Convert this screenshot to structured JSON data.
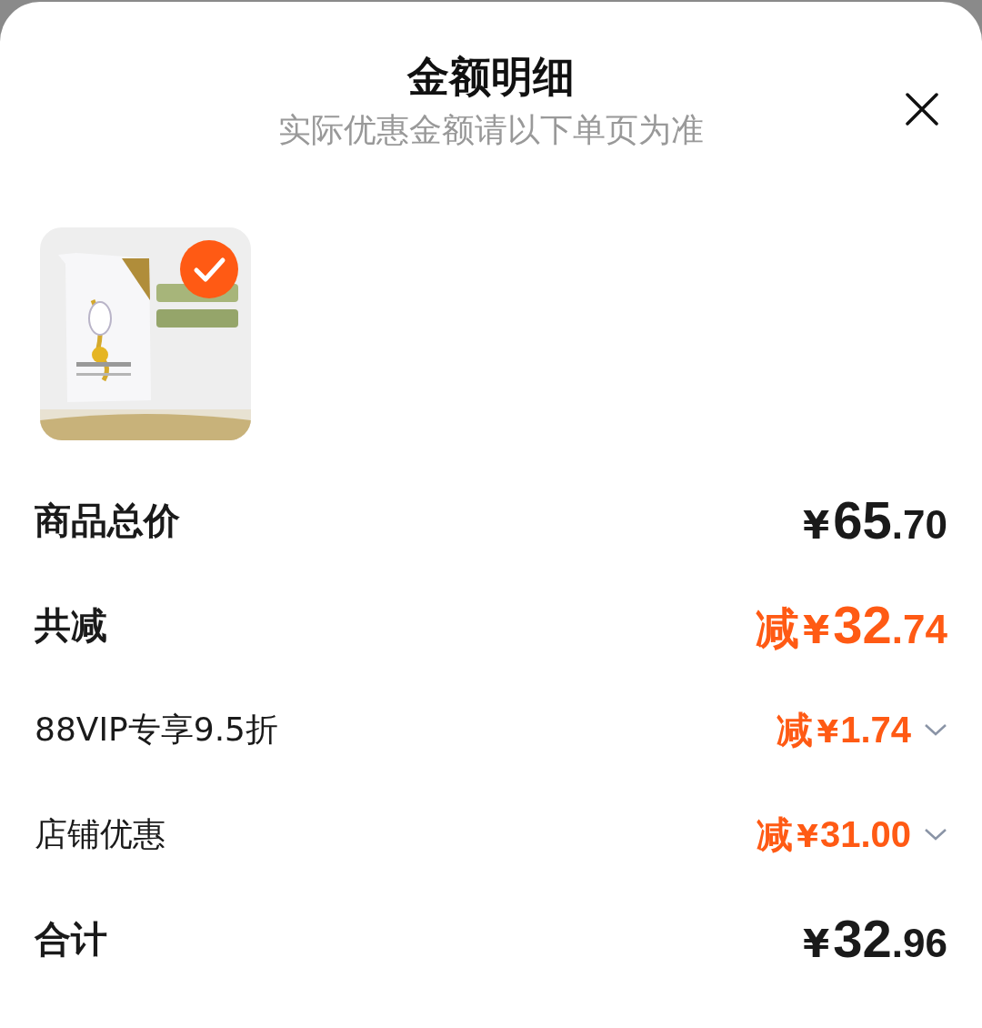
{
  "sheet": {
    "title": "金额明细",
    "subtitle": "实际优惠金额请以下单页为准"
  },
  "product": {
    "selected": true
  },
  "rows": [
    {
      "kind": "major",
      "label": "商品总价",
      "highlight": false,
      "prefix": "",
      "currency": "¥",
      "integer": "65",
      "decimal": ".70",
      "expandable": false
    },
    {
      "kind": "major",
      "label": "共减",
      "highlight": true,
      "prefix": "减",
      "currency": "¥",
      "integer": "32",
      "decimal": ".74",
      "expandable": false
    },
    {
      "kind": "detail",
      "label": "88VIP专享9.5折",
      "highlight": true,
      "prefix": "减",
      "currency": "¥",
      "integer": "1.74",
      "decimal": "",
      "expandable": true
    },
    {
      "kind": "detail",
      "label": "店铺优惠",
      "highlight": true,
      "prefix": "减",
      "currency": "¥",
      "integer": "31.00",
      "decimal": "",
      "expandable": true
    },
    {
      "kind": "major",
      "label": "合计",
      "highlight": false,
      "prefix": "",
      "currency": "¥",
      "integer": "32",
      "decimal": ".96",
      "expandable": false
    }
  ]
}
